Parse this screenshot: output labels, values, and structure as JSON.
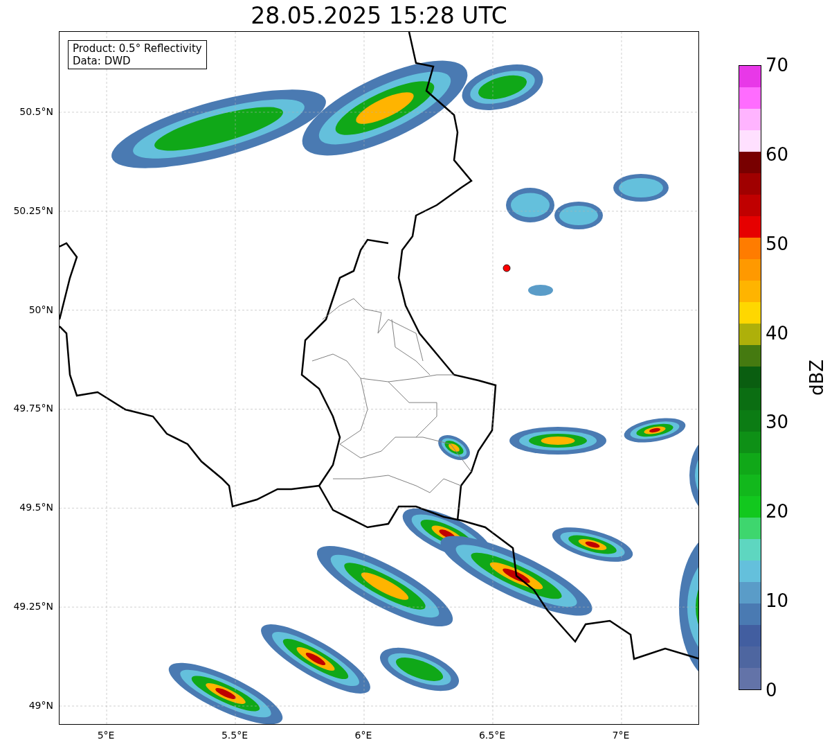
{
  "title": "28.05.2025 15:28 UTC",
  "legend": [
    "Product: 0.5° Reflectivity",
    "Data: DWD"
  ],
  "x_ticks": [
    "5°E",
    "5.5°E",
    "6°E",
    "6.5°E",
    "7°E"
  ],
  "y_ticks": [
    "50.5°N",
    "50.25°N",
    "50°N",
    "49.75°N",
    "49.5°N",
    "49.25°N",
    "49°N"
  ],
  "colorbar": {
    "ticks": [
      "70",
      "60",
      "50",
      "40",
      "30",
      "20",
      "10",
      "0"
    ],
    "label": "dBZ",
    "segments": [
      {
        "color": "#e838e8"
      },
      {
        "color": "#ff6cff"
      },
      {
        "color": "#ffb4ff"
      },
      {
        "color": "#ffe0ff"
      },
      {
        "color": "#780000"
      },
      {
        "color": "#a00000"
      },
      {
        "color": "#c00000"
      },
      {
        "color": "#e60000"
      },
      {
        "color": "#ff7c00"
      },
      {
        "color": "#ff9900"
      },
      {
        "color": "#ffb400"
      },
      {
        "color": "#ffd700"
      },
      {
        "color": "#aeb00a"
      },
      {
        "color": "#457a10"
      },
      {
        "color": "#0a5e10"
      },
      {
        "color": "#0b6e12"
      },
      {
        "color": "#0c7c14"
      },
      {
        "color": "#0e9016"
      },
      {
        "color": "#10a818"
      },
      {
        "color": "#12b81c"
      },
      {
        "color": "#12c81e"
      },
      {
        "color": "#3ed66e"
      },
      {
        "color": "#5ed6c0"
      },
      {
        "color": "#64c0dc"
      },
      {
        "color": "#5a9cc8"
      },
      {
        "color": "#4a7ab2"
      },
      {
        "color": "#425ea0"
      },
      {
        "color": "#4e66a0"
      },
      {
        "color": "#6373a8"
      }
    ]
  }
}
